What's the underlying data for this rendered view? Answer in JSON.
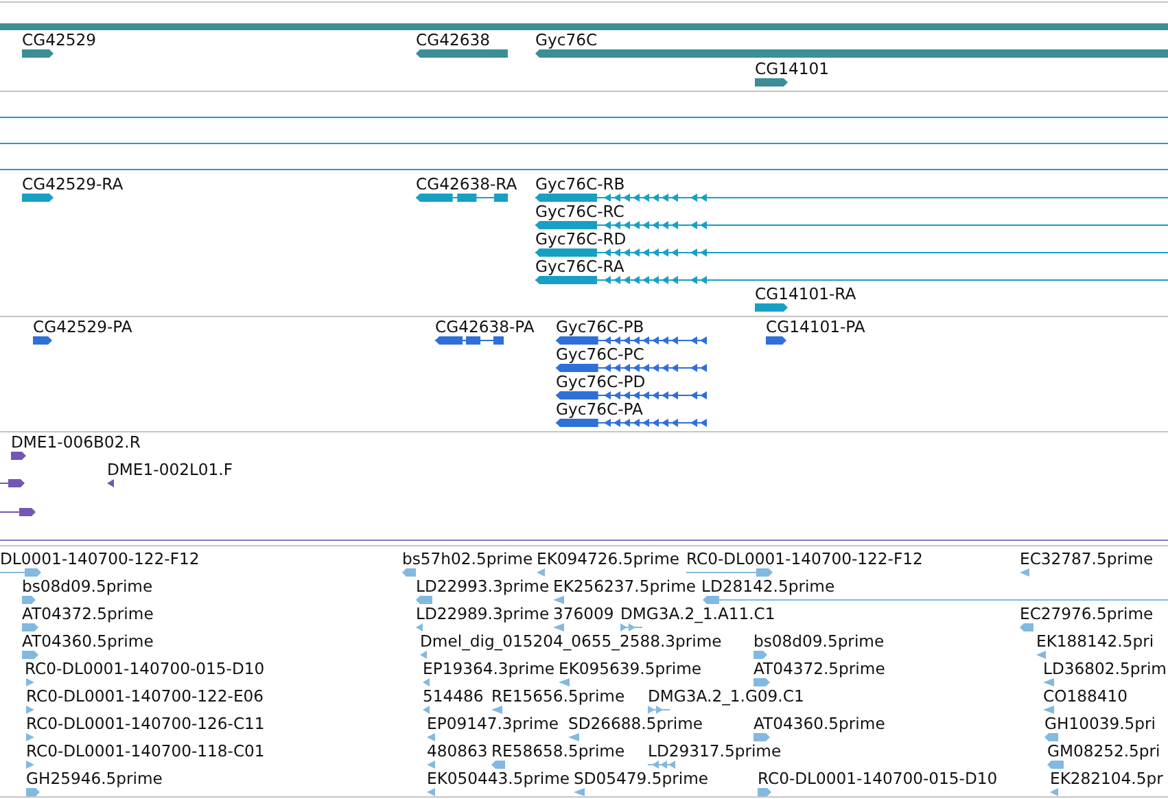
{
  "tracks": [
    {
      "kind": "gene",
      "features": [
        {
          "label": "CG42529",
          "reverse": false
        },
        {
          "label": "CG42638",
          "reverse": true
        },
        {
          "label": "Gyc76C",
          "reverse": true
        },
        {
          "label": "CG14101",
          "reverse": false
        }
      ]
    },
    {
      "kind": "mrna",
      "features": [
        {
          "label": "CG42529-RA",
          "reverse": false
        },
        {
          "label": "CG42638-RA",
          "reverse": true
        },
        {
          "label": "Gyc76C-RB",
          "reverse": true
        },
        {
          "label": "Gyc76C-RC",
          "reverse": true
        },
        {
          "label": "Gyc76C-RD",
          "reverse": true
        },
        {
          "label": "Gyc76C-RA",
          "reverse": true
        },
        {
          "label": "CG14101-RA",
          "reverse": false
        }
      ]
    },
    {
      "kind": "polypeptide",
      "features": [
        {
          "label": "CG42529-PA",
          "reverse": false
        },
        {
          "label": "CG42638-PA",
          "reverse": true
        },
        {
          "label": "Gyc76C-PB",
          "reverse": true
        },
        {
          "label": "Gyc76C-PC",
          "reverse": true
        },
        {
          "label": "Gyc76C-PD",
          "reverse": true
        },
        {
          "label": "Gyc76C-PA",
          "reverse": true
        },
        {
          "label": "CG14101-PA",
          "reverse": false
        }
      ]
    },
    {
      "kind": "clone",
      "features": [
        {
          "label": "DME1-006B02.R",
          "reverse": false
        },
        {
          "reverse": false
        },
        {
          "label": "DME1-002L01.F",
          "reverse": true
        },
        {
          "reverse": false
        }
      ]
    },
    {
      "kind": "est",
      "features": [
        {
          "label": "DL0001-140700-122-F12",
          "reverse": false
        },
        {
          "label": "bs57h02.5prime",
          "reverse": true
        },
        {
          "label": "EK094726.5prime",
          "reverse": true
        },
        {
          "label": "RC0-DL0001-140700-122-F12",
          "reverse": false
        },
        {
          "label": "EC32787.5prime",
          "reverse": true
        },
        {
          "label": "bs08d09.5prime",
          "reverse": false
        },
        {
          "label": "LD22993.3prime",
          "reverse": true
        },
        {
          "label": "EK256237.5prime",
          "reverse": true
        },
        {
          "label": "LD28142.5prime",
          "reverse": true
        },
        {
          "label": "AT04372.5prime",
          "reverse": false
        },
        {
          "label": "LD22989.3prime",
          "reverse": true
        },
        {
          "label": "376009",
          "reverse": true
        },
        {
          "label": "DMG3A.2_1.A11.C1",
          "reverse": false
        },
        {
          "label": "EC27976.5prime",
          "reverse": true
        },
        {
          "label": "AT04360.5prime",
          "reverse": false
        },
        {
          "label": "Dmel_dig_015204_0655_2588.3prime",
          "reverse": true
        },
        {
          "label": "bs08d09.5prime",
          "reverse": false
        },
        {
          "label": "EK188142.5pri",
          "reverse": true
        },
        {
          "label": "RC0-DL0001-140700-015-D10",
          "reverse": false
        },
        {
          "label": "EP19364.3prime",
          "reverse": true
        },
        {
          "label": "EK095639.5prime",
          "reverse": true
        },
        {
          "label": "AT04372.5prime",
          "reverse": false
        },
        {
          "label": "LD36802.5prim",
          "reverse": true
        },
        {
          "label": "RC0-DL0001-140700-122-E06",
          "reverse": false
        },
        {
          "label": "514486",
          "reverse": true
        },
        {
          "label": "RE15656.5prime",
          "reverse": true
        },
        {
          "label": "DMG3A.2_1.G09.C1",
          "reverse": false
        },
        {
          "label": "CO188410",
          "reverse": true
        },
        {
          "label": "RC0-DL0001-140700-126-C11",
          "reverse": false
        },
        {
          "label": "EP09147.3prime",
          "reverse": true
        },
        {
          "label": "SD26688.5prime",
          "reverse": true
        },
        {
          "label": "AT04360.5prime",
          "reverse": false
        },
        {
          "label": "GH10039.5pri",
          "reverse": true
        },
        {
          "label": "RC0-DL0001-140700-118-C01",
          "reverse": false
        },
        {
          "label": "480863",
          "reverse": true
        },
        {
          "label": "RE58658.5prime",
          "reverse": true
        },
        {
          "label": "LD29317.5prime",
          "reverse": true
        },
        {
          "label": "GM08252.5pri",
          "reverse": true
        },
        {
          "label": "GH25946.5prime",
          "reverse": false
        },
        {
          "label": "EK050443.5prime",
          "reverse": true
        },
        {
          "label": "SD05479.5prime",
          "reverse": true
        },
        {
          "label": "RC0-DL0001-140700-015-D10",
          "reverse": false
        },
        {
          "label": "EK282104.5pr",
          "reverse": true
        }
      ]
    }
  ]
}
